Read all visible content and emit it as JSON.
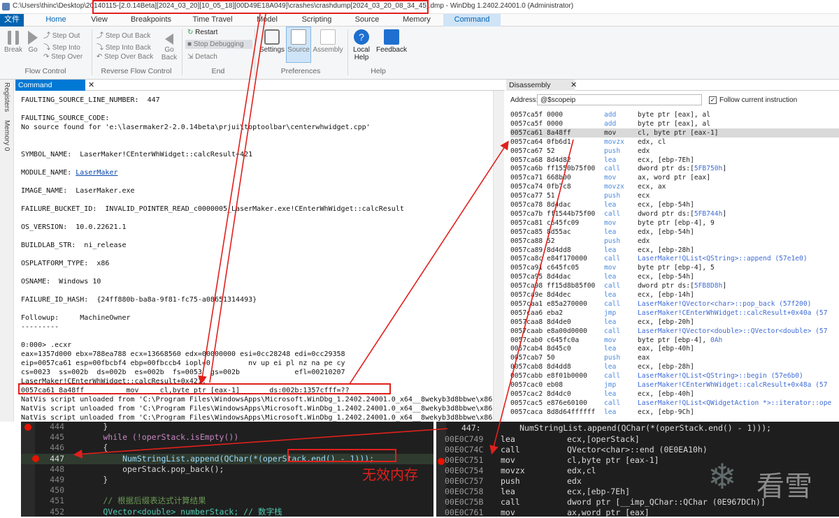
{
  "window": {
    "title": "C:\\Users\\thinc\\Desktop\\20140115-[2.0.14Beta][2024_03_20][10_05_18][00D49E18A049]\\crashes\\crashdump[2024_03_20_08_34_45].dmp - WinDbg 1.2402.24001.0 (Administrator)"
  },
  "tabs": [
    "文件",
    "Home",
    "View",
    "Breakpoints",
    "Time Travel",
    "Model",
    "Scripting",
    "Source",
    "Memory",
    "Command"
  ],
  "ribbon": {
    "flow": {
      "break": "Break",
      "go": "Go",
      "step_out": "Step Out",
      "step_into": "Step Into",
      "step_over": "Step Over",
      "label": "Flow Control"
    },
    "reverse": {
      "step_out_back": "Step Out Back",
      "step_into_back": "Step Into Back",
      "step_over_back": "Step Over Back",
      "go_back": "Go Back",
      "label": "Reverse Flow Control"
    },
    "end": {
      "restart": "Restart",
      "stop": "Stop Debugging",
      "detach": "Detach",
      "label": "End"
    },
    "prefs": {
      "settings": "Settings",
      "source": "Source",
      "assembly": "Assembly",
      "label": "Preferences"
    },
    "help": {
      "local_help": "Local Help",
      "feedback": "Feedback",
      "label": "Help"
    }
  },
  "side": {
    "registers": "Registers",
    "memory": "Memory 0"
  },
  "command": {
    "tab": "Command",
    "lines": [
      "FAULTING_SOURCE_LINE_NUMBER:  447",
      "",
      "FAULTING_SOURCE_CODE:",
      "No source found for 'e:\\lasermaker2-2.0.14beta\\prjui\\toptoolbar\\centerwhwidget.cpp'",
      "",
      "",
      "SYMBOL_NAME:  LaserMaker!CEnterWhWidget::calcResult+421",
      "",
      "MODULE_NAME: LaserMaker",
      "",
      "IMAGE_NAME:  LaserMaker.exe",
      "",
      "FAILURE_BUCKET_ID:  INVALID_POINTER_READ_c0000005_LaserMaker.exe!CEnterWhWidget::calcResult",
      "",
      "OS_VERSION:  10.0.22621.1",
      "",
      "BUILDLAB_STR:  ni_release",
      "",
      "OSPLATFORM_TYPE:  x86",
      "",
      "OSNAME:  Windows 10",
      "",
      "FAILURE_ID_HASH:  {24ff880b-ba8a-9f81-fc75-a08651314493}",
      "",
      "Followup:     MachineOwner",
      "---------",
      "",
      "0:000> .ecxr",
      "eax=1357d000 ebx=788ea788 ecx=13668560 edx=00000000 esi=0cc28248 edi=0cc29358",
      "eip=0057ca61 esp=00fbcbf4 ebp=00fbccb4 iopl=0         nv up ei pl nz na pe cy",
      "cs=0023  ss=002b  ds=002b  es=002b  fs=0053  gs=002b             efl=00210207",
      "LaserMaker!CEnterWhWidget::calcResult+0x421:",
      "0057ca61 8a48ff          mov     cl,byte ptr [eax-1]       ds:002b:1357cfff=??",
      "NatVis script unloaded from 'C:\\Program Files\\WindowsApps\\Microsoft.WinDbg_1.2402.24001.0_x64__8wekyb3d8bbwe\\x86",
      "NatVis script unloaded from 'C:\\Program Files\\WindowsApps\\Microsoft.WinDbg_1.2402.24001.0_x64__8wekyb3d8bbwe\\x86",
      "NatVis script unloaded from 'C:\\Program Files\\WindowsApps\\Microsoft.WinDbg_1.2402.24001.0_x64__8wekyb3d8bbwe\\x86"
    ]
  },
  "disassembly": {
    "tab": "Disassembly",
    "address_label": "Address:",
    "address_value": "@$scopeip",
    "follow": "Follow current instruction",
    "rows": [
      [
        "0057ca5f 0000",
        "add",
        "byte ptr [eax], al"
      ],
      [
        "0057ca5f 0000",
        "add",
        "byte ptr [eax], al"
      ],
      [
        "0057ca61 8a48ff",
        "mov",
        "cl, byte ptr [eax-1]"
      ],
      [
        "0057ca64 0fb6d1",
        "movzx",
        "edx, cl"
      ],
      [
        "0057ca67 52",
        "push",
        "edx"
      ],
      [
        "0057ca68 8d4d82",
        "lea",
        "ecx, [ebp-7Eh]"
      ],
      [
        "0057ca6b ff1550b75f00",
        "call",
        "dword ptr ds:[5FB750h]"
      ],
      [
        "0057ca71 668b00",
        "mov",
        "ax, word ptr [eax]"
      ],
      [
        "0057ca74 0fb7c8",
        "movzx",
        "ecx, ax"
      ],
      [
        "0057ca77 51",
        "push",
        "ecx"
      ],
      [
        "0057ca78 8d4dac",
        "lea",
        "ecx, [ebp-54h]"
      ],
      [
        "0057ca7b ff1544b75f00",
        "call",
        "dword ptr ds:[5FB744h]"
      ],
      [
        "0057ca81 c645fc09",
        "mov",
        "byte ptr [ebp-4], 9"
      ],
      [
        "0057ca85 8d55ac",
        "lea",
        "edx, [ebp-54h]"
      ],
      [
        "0057ca88 52",
        "push",
        "edx"
      ],
      [
        "0057ca89 8d4dd8",
        "lea",
        "ecx, [ebp-28h]"
      ],
      [
        "0057ca8c e84f170000",
        "call",
        "LaserMaker!QList<QString>::append (57e1e0)"
      ],
      [
        "0057ca91 c645fc05",
        "mov",
        "byte ptr [ebp-4], 5"
      ],
      [
        "0057ca95 8d4dac",
        "lea",
        "ecx, [ebp-54h]"
      ],
      [
        "0057ca98 ff15d8b85f00",
        "call",
        "dword ptr ds:[5FB8D8h]"
      ],
      [
        "0057ca9e 8d4dec",
        "lea",
        "ecx, [ebp-14h]"
      ],
      [
        "0057caa1 e85a270000",
        "call",
        "LaserMaker!QVector<char>::pop_back (57f200)"
      ],
      [
        "0057caa6 eba2",
        "jmp",
        "LaserMaker!CEnterWhWidget::calcResult+0x40a (57"
      ],
      [
        "0057caa8 8d4de0",
        "lea",
        "ecx, [ebp-20h]"
      ],
      [
        "0057caab e8a00d0000",
        "call",
        "LaserMaker!QVector<double>::QVector<double> (57"
      ],
      [
        "0057cab0 c645fc0a",
        "mov",
        "byte ptr [ebp-4], 0Ah"
      ],
      [
        "0057cab4 8d45c0",
        "lea",
        "eax, [ebp-40h]"
      ],
      [
        "0057cab7 50",
        "push",
        "eax"
      ],
      [
        "0057cab8 8d4dd8",
        "lea",
        "ecx, [ebp-28h]"
      ],
      [
        "0057cabb e8f01b0000",
        "call",
        "LaserMaker!QList<QString>::begin (57e6b0)"
      ],
      [
        "0057cac0 eb08",
        "jmp",
        "LaserMaker!CEnterWhWidget::calcResult+0x48a (57"
      ],
      [
        "0057cac2 8d4dc0",
        "lea",
        "ecx, [ebp-40h]"
      ],
      [
        "0057cac5 e876e60100",
        "call",
        "LaserMaker!QList<QWidgetAction *>::iterator::ope"
      ],
      [
        "0057caca 8d8d64ffffff",
        "lea",
        "ecx, [ebp-9Ch]"
      ]
    ]
  },
  "source": {
    "lines": [
      [
        "444",
        "        }"
      ],
      [
        "445",
        "        while (!operStack.isEmpty())"
      ],
      [
        "446",
        "        {"
      ],
      [
        "447",
        "            NumStringList.append(QChar(*(operStack.end() - 1)));"
      ],
      [
        "448",
        "            operStack.pop_back();"
      ],
      [
        "449",
        "        }"
      ],
      [
        "450",
        ""
      ],
      [
        "451",
        "        // 根据后缀表达式计算结果"
      ],
      [
        "452",
        "        QVector<double> numberStack; // 数字栈"
      ]
    ]
  },
  "asm": {
    "header": "447:        NumStringList.append(QChar(*(operStack.end() - 1)));",
    "rows": [
      [
        "00E0C749",
        "lea",
        "ecx,[operStack]"
      ],
      [
        "00E0C74C",
        "call",
        "QVector<char>::end (0E0EA10h)"
      ],
      [
        "00E0C751",
        "mov",
        "cl,byte ptr [eax-1]"
      ],
      [
        "00E0C754",
        "movzx",
        "edx,cl"
      ],
      [
        "00E0C757",
        "push",
        "edx"
      ],
      [
        "00E0C758",
        "lea",
        "ecx,[ebp-7Eh]"
      ],
      [
        "00E0C75B",
        "call",
        "dword ptr [__imp_QChar::QChar (0E967DCh)]"
      ],
      [
        "00E0C761",
        "mov",
        "ax,word ptr [eax]"
      ]
    ]
  },
  "annotation": {
    "invalid_memory": "无效内存"
  },
  "watermark": {
    "text": "看雪"
  },
  "colors": {
    "accent": "#0078d4",
    "annotation": "#e0201c",
    "breakpoint": "#e51400"
  }
}
